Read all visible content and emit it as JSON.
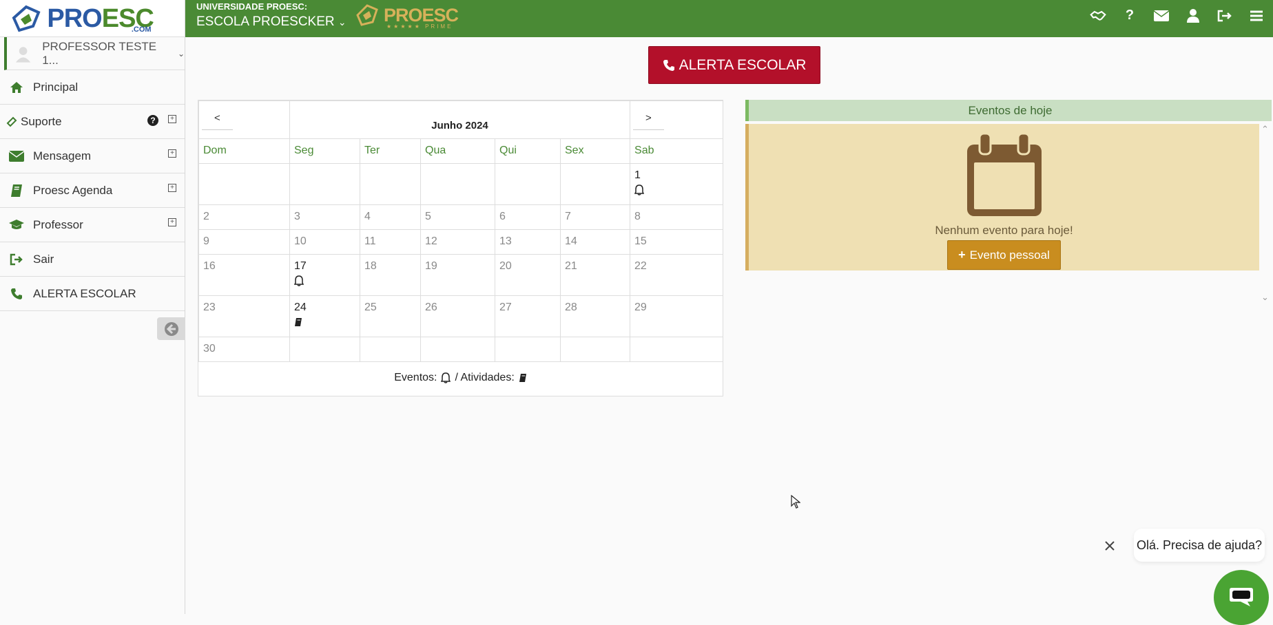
{
  "sidebar": {
    "logo": {
      "part1": "PRO",
      "part2": "ESC",
      "suffix": ".COM"
    },
    "user": "PROFESSOR TESTE 1...",
    "items": [
      {
        "label": "Principal"
      },
      {
        "label": "Suporte"
      },
      {
        "label": "Mensagem"
      },
      {
        "label": "Proesc Agenda"
      },
      {
        "label": "Professor"
      },
      {
        "label": "Sair"
      },
      {
        "label": "ALERTA ESCOLAR"
      }
    ]
  },
  "topbar": {
    "university": "UNIVERSIDADE PROESC:",
    "school": "ESCOLA PROESCKER",
    "prime_logo": "PROESC",
    "prime_sub": "★★★★★ PRIME"
  },
  "main": {
    "alert_button": "ALERTA ESCOLAR"
  },
  "calendar": {
    "prev": "<",
    "next": ">",
    "month": "Junho 2024",
    "weekdays": [
      "Dom",
      "Seg",
      "Ter",
      "Qua",
      "Qui",
      "Sex",
      "Sab"
    ],
    "weeks": [
      [
        "",
        "",
        "",
        "",
        "",
        "",
        "1"
      ],
      [
        "2",
        "3",
        "4",
        "5",
        "6",
        "7",
        "8"
      ],
      [
        "9",
        "10",
        "11",
        "12",
        "13",
        "14",
        "15"
      ],
      [
        "16",
        "17",
        "18",
        "19",
        "20",
        "21",
        "22"
      ],
      [
        "23",
        "24",
        "25",
        "26",
        "27",
        "28",
        "29"
      ],
      [
        "30",
        "",
        "",
        "",
        "",
        "",
        ""
      ]
    ],
    "legend_events": "Eventos:",
    "legend_sep": "/ Atividades:"
  },
  "events": {
    "header": "Eventos de hoje",
    "empty_text": "Nenhum evento para hoje!",
    "button": "Evento pessoal"
  },
  "chat": {
    "message": "Olá. Precisa de ajuda?"
  },
  "colors": {
    "brand_green": "#4a8a35",
    "alert_red": "#b3102a",
    "event_gold": "#c98d1f"
  }
}
